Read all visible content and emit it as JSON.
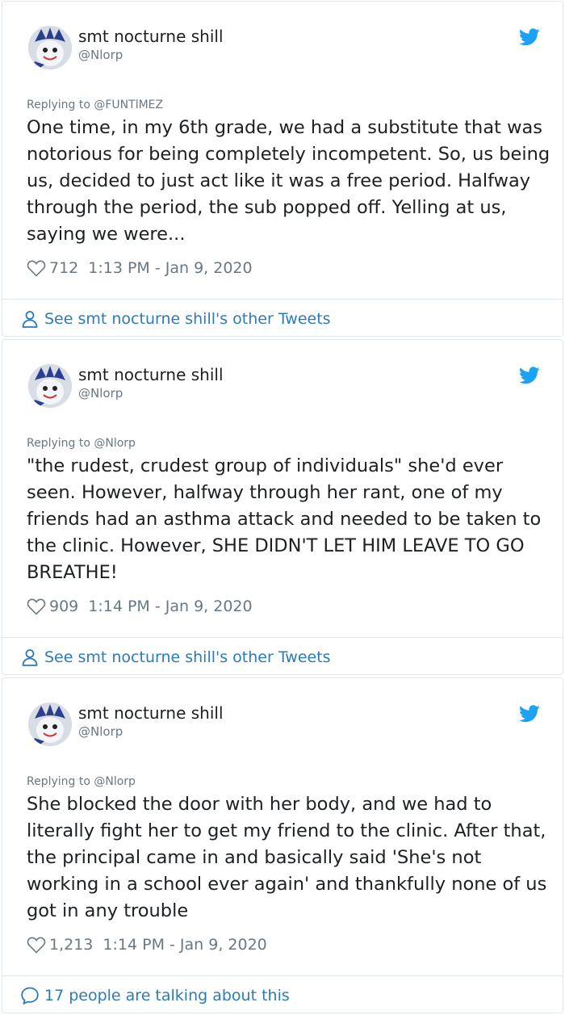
{
  "tweets": [
    {
      "display_name": "smt nocturne shill",
      "handle": "@Nlorp",
      "replying_to": "Replying to @FUNTlMEZ",
      "text": "One time, in my 6th grade, we had a substitute that was notorious for being completely incompetent. So, us being us, decided to just act like it was a free period. Halfway through the period, the sub popped off. Yelling at us, saying we were...",
      "likes": "712",
      "timestamp": "1:13 PM - Jan 9, 2020",
      "footer": "See smt nocturne shill's other Tweets",
      "footer_icon": "person-icon"
    },
    {
      "display_name": "smt nocturne shill",
      "handle": "@Nlorp",
      "replying_to": "Replying to @Nlorp",
      "text": "\"the rudest, crudest group of individuals\" she'd ever seen. However, halfway through her rant, one of my friends had an asthma attack and needed to be taken to the clinic. However, SHE DIDN'T LET HIM LEAVE TO GO BREATHE!",
      "likes": "909",
      "timestamp": "1:14 PM - Jan 9, 2020",
      "footer": "See smt nocturne shill's other Tweets",
      "footer_icon": "person-icon"
    },
    {
      "display_name": "smt nocturne shill",
      "handle": "@Nlorp",
      "replying_to": "Replying to @Nlorp",
      "text": "She blocked the door with her body, and we had to literally fight her to get my friend to the clinic. After that, the principal came in and basically said 'She's not working in a school ever again' and thankfully none of us got in any trouble",
      "likes": "1,213",
      "timestamp": "1:14 PM - Jan 9, 2020",
      "footer": "17 people are talking about this",
      "footer_icon": "speech-bubble-icon"
    }
  ],
  "colors": {
    "text": "#1c2022",
    "muted": "#697882",
    "link": "#2b7bb9",
    "twitter_blue": "#1da1f2",
    "border": "#e1e8ed"
  }
}
